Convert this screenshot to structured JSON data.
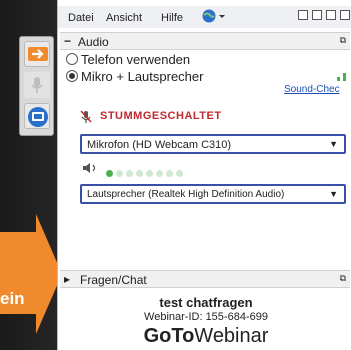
{
  "menubar": {
    "items": [
      "Datei",
      "Ansicht",
      "Hilfe"
    ]
  },
  "audio": {
    "section_title": "Audio",
    "collapse_symbol": "−",
    "option_phone": "Telefon verwenden",
    "option_mic": "Mikro + Lautsprecher",
    "selected_option": "Mikro + Lautsprecher",
    "sound_check_link": "Sound-Chec",
    "mute_status": "STUMMGESCHALTET",
    "microphone_select": "Mikrofon (HD Webcam C310)",
    "speaker_select": "Lautsprecher (Realtek High Definition Audio)",
    "mic_level_active_dots": 1,
    "mic_level_total_dots": 8
  },
  "chat": {
    "section_title": "Fragen/Chat",
    "expand_symbol": "▸",
    "webinar_title": "test chatfragen",
    "webinar_id": "Webinar-ID: 155-684-699",
    "brand_goto": "GoTo",
    "brand_webinar": "Webinar"
  },
  "overlay": {
    "arrow_text": "ein"
  },
  "colors": {
    "accent_orange": "#f08a2c",
    "mute_red": "#c0282e",
    "select_border": "#3a4fa8",
    "link_blue": "#1b4fb8"
  }
}
